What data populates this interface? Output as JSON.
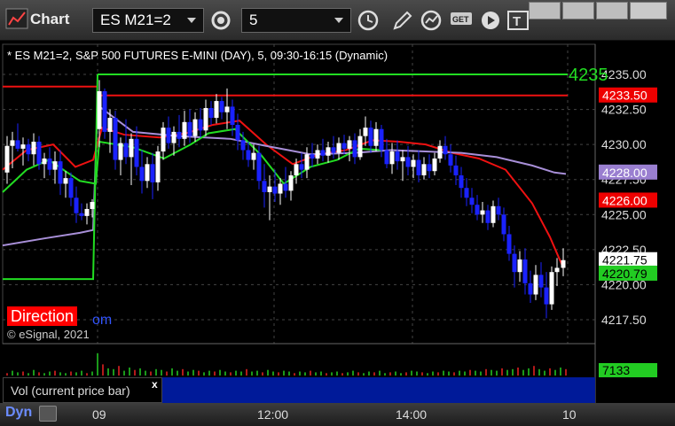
{
  "window": {
    "title": "Chart",
    "symbol_value": "ES M21=2",
    "interval_value": "5"
  },
  "chart": {
    "description": "* ES M21=2, S&P 500 FUTURES E-MINI (DAY), 5, 09:30-16:15 (Dynamic)",
    "direction_label": "Direction",
    "link_fragment": "om",
    "copyright": "© eSignal, 2021",
    "price_ticks": [
      "4235.00",
      "4232.50",
      "4230.00",
      "4227.50",
      "4225.00",
      "4222.50",
      "4220.00",
      "4217.50"
    ],
    "price_tick_values": [
      4235.0,
      4232.5,
      4230.0,
      4227.5,
      4225.0,
      4222.5,
      4220.0,
      4217.5
    ],
    "y_range": [
      4215.5,
      4236.5
    ],
    "time_ticks": [
      "09",
      "12:00",
      "14:00",
      "10"
    ],
    "price_badges": [
      {
        "label": "4233.50",
        "value": 4233.5,
        "color": "#ee0000",
        "text_color": "#ffffff"
      },
      {
        "label": "4228.00",
        "value": 4228.0,
        "color": "#9a7fd0",
        "text_color": "#ffffff"
      },
      {
        "label": "4226.00",
        "value": 4226.0,
        "color": "#ee0000",
        "text_color": "#ffffff"
      },
      {
        "label": "4221.75",
        "value": 4221.75,
        "color": "#ffffff",
        "text_color": "#000000"
      },
      {
        "label": "4220.79",
        "value": 4220.79,
        "color": "#22cc22",
        "text_color": "#000000"
      }
    ],
    "green_line_label": "4235",
    "green_line_value": 4235.0,
    "red_line_value": 4233.5,
    "colors": {
      "up": "#ffffff",
      "down": "#1a22ff",
      "ma_green": "#22dd22",
      "ma_red": "#ee1111",
      "ma_purple": "#a88fd8"
    }
  },
  "volume": {
    "label": "Vol (current price bar)",
    "close_symbol": "x",
    "value_badge": "7133"
  },
  "bottom": {
    "label": "Dyn"
  }
}
